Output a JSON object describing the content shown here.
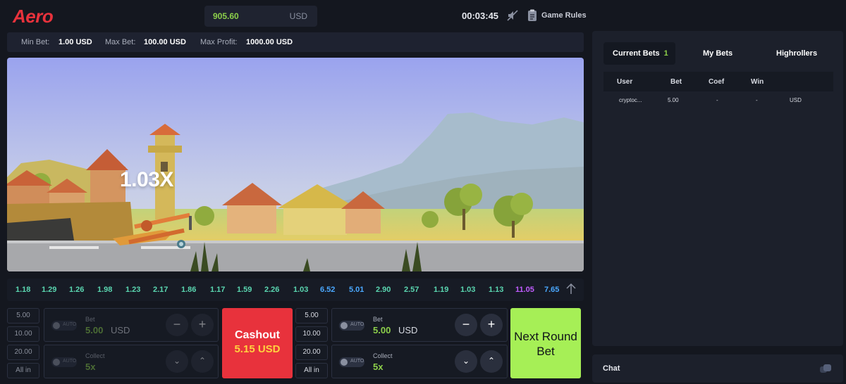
{
  "header": {
    "logo": "Aero",
    "balance": "905.60",
    "currency": "USD",
    "timer": "00:03:45",
    "sound_icon": "sound-muted-icon",
    "rules_icon": "document-icon",
    "rules_label": "Game Rules"
  },
  "limits": {
    "min_label": "Min Bet:",
    "min_value": "1.00 USD",
    "max_label": "Max Bet:",
    "max_value": "100.00 USD",
    "profit_label": "Max Profit:",
    "profit_value": "1000.00 USD"
  },
  "game": {
    "multiplier": "1.03X"
  },
  "history": [
    {
      "v": "1.18",
      "c": "#5ad6b0"
    },
    {
      "v": "1.29",
      "c": "#5ad6b0"
    },
    {
      "v": "1.26",
      "c": "#5ad6b0"
    },
    {
      "v": "1.98",
      "c": "#5ad6b0"
    },
    {
      "v": "1.23",
      "c": "#5ad6b0"
    },
    {
      "v": "2.17",
      "c": "#5ad6b0"
    },
    {
      "v": "1.86",
      "c": "#5ad6b0"
    },
    {
      "v": "1.17",
      "c": "#5ad6b0"
    },
    {
      "v": "1.59",
      "c": "#5ad6b0"
    },
    {
      "v": "2.26",
      "c": "#5ad6b0"
    },
    {
      "v": "1.03",
      "c": "#5ad6b0"
    },
    {
      "v": "6.52",
      "c": "#4aa8ff"
    },
    {
      "v": "5.01",
      "c": "#4aa8ff"
    },
    {
      "v": "2.90",
      "c": "#5ad6b0"
    },
    {
      "v": "2.57",
      "c": "#5ad6b0"
    },
    {
      "v": "1.19",
      "c": "#5ad6b0"
    },
    {
      "v": "1.03",
      "c": "#5ad6b0"
    },
    {
      "v": "1.13",
      "c": "#5ad6b0"
    },
    {
      "v": "11.05",
      "c": "#c05cff"
    },
    {
      "v": "7.65",
      "c": "#4aa8ff"
    }
  ],
  "panel_left": {
    "quick": [
      "5.00",
      "10.00",
      "20.00",
      "All in"
    ],
    "auto_label": "AUTO",
    "bet_label": "Bet",
    "bet_value": "5.00",
    "bet_currency": "USD",
    "collect_label": "Collect",
    "collect_value": "5x"
  },
  "cashout": {
    "label": "Cashout",
    "amount": "5.15 USD"
  },
  "panel_right": {
    "quick": [
      "5.00",
      "10.00",
      "20.00",
      "All in"
    ],
    "auto_label": "AUTO",
    "bet_label": "Bet",
    "bet_value": "5.00",
    "bet_currency": "USD",
    "collect_label": "Collect",
    "collect_value": "5x"
  },
  "next_bet": {
    "line1": "Next Round",
    "line2": "Bet"
  },
  "bets_panel": {
    "tabs": [
      {
        "label": "Current Bets",
        "count": "1"
      },
      {
        "label": "My Bets"
      },
      {
        "label": "Highrollers"
      }
    ],
    "columns": [
      "User",
      "Bet",
      "Coef",
      "Win"
    ],
    "rows": [
      {
        "user": "cryptoc...",
        "bet": "5.00",
        "coef": "-",
        "win": "-",
        "currency": "USD"
      }
    ]
  },
  "chat": {
    "label": "Chat",
    "icon": "chat-icon"
  },
  "colors": {
    "brand_red": "#e8323c",
    "accent_green": "#8ccf4a",
    "next_bet_green": "#a6ef56",
    "panel_bg": "#1c202b"
  }
}
